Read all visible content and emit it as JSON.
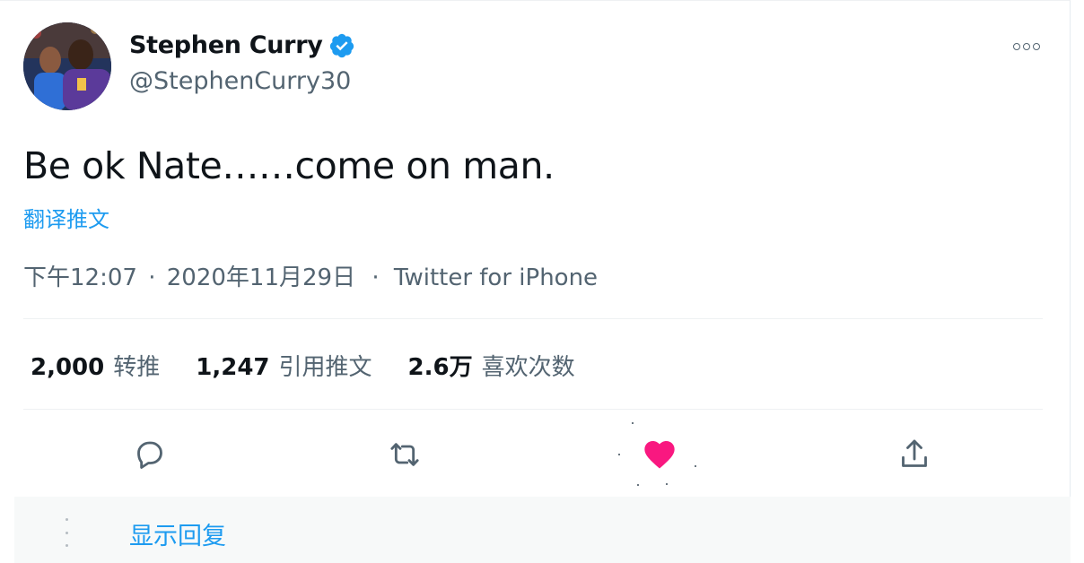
{
  "author": {
    "display_name": "Stephen Curry",
    "handle": "@StephenCurry30",
    "verified": true
  },
  "tweet": {
    "text": "Be ok Nate……come on man.",
    "translate_label": "翻译推文",
    "time": "下午12:07",
    "date": "2020年11月29日",
    "separator": "·",
    "source": "Twitter for iPhone"
  },
  "stats": [
    {
      "value": "2,000",
      "label": "转推"
    },
    {
      "value": "1,247",
      "label": "引用推文"
    },
    {
      "value": "2.6万",
      "label": "喜欢次数"
    }
  ],
  "actions": [
    {
      "name": "reply",
      "icon": "reply-icon"
    },
    {
      "name": "retweet",
      "icon": "retweet-icon"
    },
    {
      "name": "like",
      "icon": "heart-icon",
      "liked": true
    },
    {
      "name": "share",
      "icon": "share-icon"
    }
  ],
  "replies": {
    "show_label": "显示回复"
  },
  "colors": {
    "accent": "#1d9bf0",
    "like": "#f91880",
    "text": "#0f1419",
    "muted": "#536471"
  }
}
